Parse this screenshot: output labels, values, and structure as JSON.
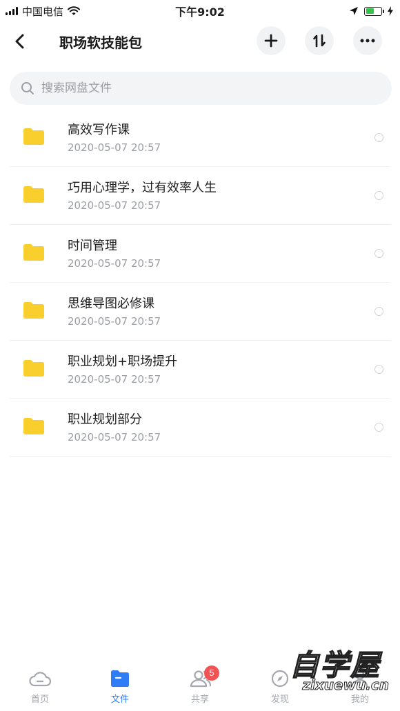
{
  "status_bar": {
    "carrier": "中国电信",
    "time": "下午9:02",
    "battery_color": "#36c24a"
  },
  "header": {
    "title": "职场软技能包",
    "icons": [
      "back-icon",
      "plus-icon",
      "sort-icon",
      "more-icon"
    ]
  },
  "search": {
    "placeholder": "搜索网盘文件"
  },
  "files": [
    {
      "name": "高效写作课",
      "date": "2020-05-07 20:57"
    },
    {
      "name": "巧用心理学，过有效率人生",
      "date": "2020-05-07 20:57"
    },
    {
      "name": "时间管理",
      "date": "2020-05-07 20:57"
    },
    {
      "name": "思维导图必修课",
      "date": "2020-05-07 20:57"
    },
    {
      "name": "职业规划+职场提升",
      "date": "2020-05-07 20:57"
    },
    {
      "name": "职业规划部分",
      "date": "2020-05-07 20:57"
    }
  ],
  "tab_bar": {
    "active_color": "#2f7cf6",
    "tabs": [
      {
        "label": "首页",
        "icon": "cloud-icon"
      },
      {
        "label": "文件",
        "icon": "folder-icon"
      },
      {
        "label": "共享",
        "icon": "people-icon",
        "badge": "5"
      },
      {
        "label": "发现",
        "icon": "discover-icon"
      },
      {
        "label": "我的",
        "icon": "profile-icon"
      }
    ]
  },
  "watermark": {
    "main": "自学屋",
    "sub": "zixuewu.cn"
  },
  "colors": {
    "folder": "#f8cf2c",
    "badge": "#f35353"
  }
}
